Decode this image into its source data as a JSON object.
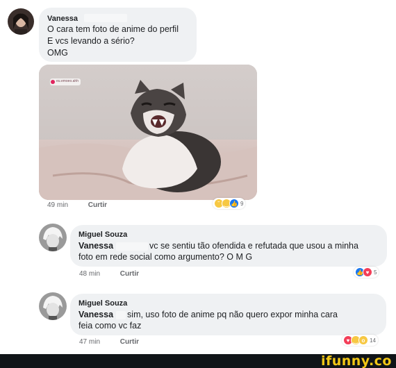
{
  "comment1": {
    "author": "Vanessa",
    "lines": [
      "O cara tem foto de anime do perfil",
      "E vcs levando a sério?",
      "OMG"
    ],
    "image_watermark": "eu.emoeo.ahh",
    "time": "49 min",
    "like_label": "Curtir",
    "reaction_count": "9"
  },
  "reply1": {
    "author": "Miguel Souza",
    "mention": "Vanessa",
    "text_rest": "vc se sentiu tão ofendida e refutada que usou a minha",
    "text_line2": "foto em rede social como argumento? O M G",
    "time": "48 min",
    "like_label": "Curtir",
    "reaction_count": "5"
  },
  "reply2": {
    "author": "Miguel Souza",
    "mention": "Vanessa",
    "text_rest": "sim, uso foto de anime pq não quero expor minha cara",
    "text_line2": "feia como vc faz",
    "time": "47 min",
    "like_label": "Curtir",
    "reaction_count": "14"
  },
  "footer": {
    "brand": "ifunny.co"
  },
  "colors": {
    "bubble": "#eff1f3",
    "like_blue": "#1877f2",
    "love_red": "#f33e58",
    "emoji_yellow": "#f7c843",
    "brand_yellow": "#f2c716"
  }
}
